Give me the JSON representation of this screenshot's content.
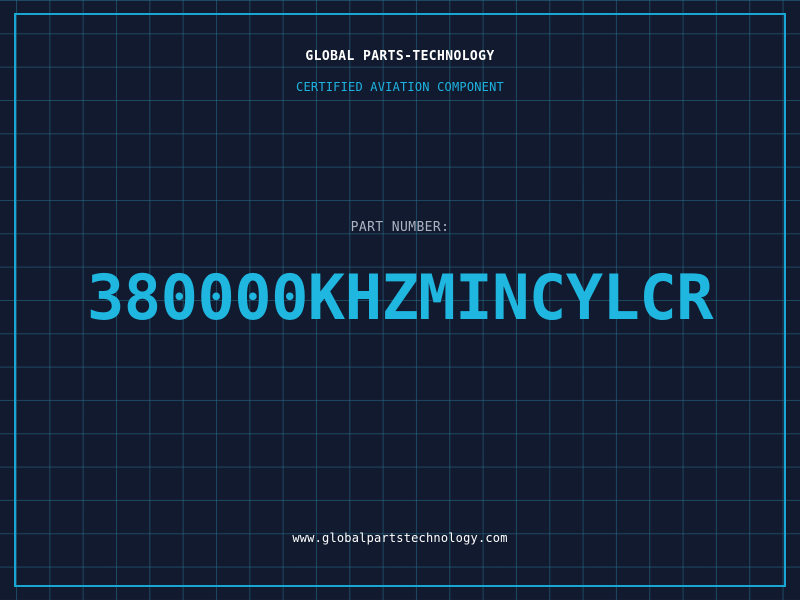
{
  "header": {
    "company": "GLOBAL PARTS-TECHNOLOGY",
    "tagline": "CERTIFIED AVIATION COMPONENT"
  },
  "part": {
    "label": "PART NUMBER:",
    "number": "380000KHZMINCYLCR"
  },
  "footer": {
    "website": "www.globalpartstechnology.com"
  },
  "colors": {
    "background": "#111a2e",
    "accent": "#1fb6e0",
    "grid": "#286e8c",
    "text": "#ffffff",
    "label": "#aab4c3"
  }
}
